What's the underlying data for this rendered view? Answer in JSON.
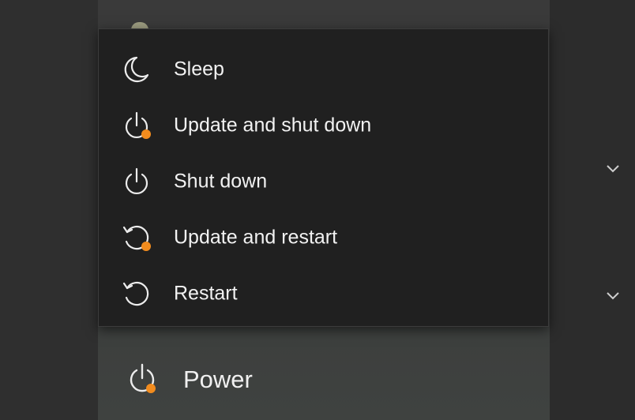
{
  "menu": {
    "items": [
      {
        "label": "Sleep",
        "icon": "moon-icon"
      },
      {
        "label": "Update and shut down",
        "icon": "power-update-icon"
      },
      {
        "label": "Shut down",
        "icon": "power-icon"
      },
      {
        "label": "Update and restart",
        "icon": "restart-update-icon"
      },
      {
        "label": "Restart",
        "icon": "restart-icon"
      }
    ]
  },
  "power_button": {
    "label": "Power",
    "icon": "power-update-icon"
  },
  "colors": {
    "update_badge": "#f28c1e",
    "menu_bg": "#202020",
    "text": "#f2f2f2"
  }
}
